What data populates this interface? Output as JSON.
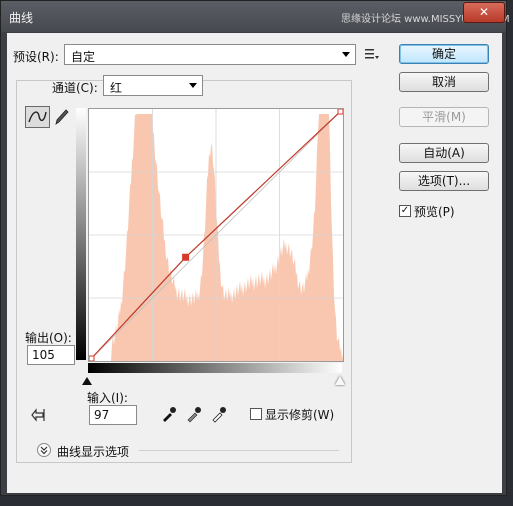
{
  "window": {
    "title": "曲线",
    "close": "✕",
    "watermark": "思缘设计论坛 www.MISSYUAN.COM"
  },
  "preset": {
    "label": "预设(R):",
    "value": "自定"
  },
  "channel": {
    "label": "通道(C):",
    "value": "红"
  },
  "output": {
    "label": "输出(O):",
    "value": "105"
  },
  "input": {
    "label": "输入(I):",
    "value": "97"
  },
  "buttons": {
    "ok": "确定",
    "cancel": "取消",
    "smooth": "平滑(M)",
    "auto": "自动(A)",
    "options": "选项(T)..."
  },
  "preview": {
    "label": "预览(P)",
    "checked": "✓"
  },
  "show_clipping": {
    "label": "显示修剪(W)"
  },
  "curve_display": {
    "label": "曲线显示选项"
  },
  "colors": {
    "histogram": "#f9c7b0",
    "curve": "#c0392b",
    "point": "#d8392b"
  },
  "curve": {
    "points": [
      {
        "input": 0,
        "output": 0
      },
      {
        "input": 97,
        "output": 105
      },
      {
        "input": 255,
        "output": 255
      }
    ],
    "selected_point": {
      "input": 97,
      "output": 105
    }
  }
}
